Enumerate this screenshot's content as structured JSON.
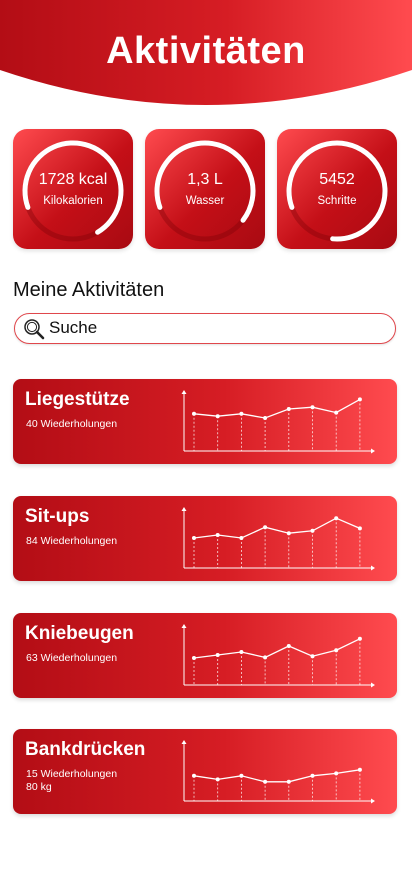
{
  "header": {
    "title": "Aktivitäten"
  },
  "colors": {
    "accent": "#d61d24",
    "accent_light": "#ff4b4f",
    "accent_dark": "#a80a12"
  },
  "stats": [
    {
      "value": "1728 kcal",
      "label": "Kilokalorien",
      "progress": 0.72
    },
    {
      "value": "1,3 L",
      "label": "Wasser",
      "progress": 0.66
    },
    {
      "value": "5452",
      "label": "Schritte",
      "progress": 0.82
    }
  ],
  "section": {
    "title": "Meine Aktivitäten"
  },
  "search": {
    "placeholder": "Suche",
    "value": ""
  },
  "activities": [
    {
      "name": "Liegestütze",
      "detail": "40 Wiederholungen",
      "detail2": "",
      "points": [
        0.62,
        0.58,
        0.62,
        0.55,
        0.7,
        0.73,
        0.64,
        0.86
      ]
    },
    {
      "name": "Sit-ups",
      "detail": "84 Wiederholungen",
      "detail2": "",
      "points": [
        0.5,
        0.55,
        0.5,
        0.68,
        0.58,
        0.62,
        0.83,
        0.66
      ]
    },
    {
      "name": "Kniebeugen",
      "detail": "63 Wiederholungen",
      "detail2": "",
      "points": [
        0.45,
        0.5,
        0.55,
        0.46,
        0.65,
        0.48,
        0.58,
        0.77
      ]
    },
    {
      "name": "Bankdrücken",
      "detail": "15 Wiederholungen",
      "detail2": "80 kg",
      "points": [
        0.42,
        0.36,
        0.42,
        0.32,
        0.32,
        0.42,
        0.46,
        0.52
      ]
    }
  ]
}
